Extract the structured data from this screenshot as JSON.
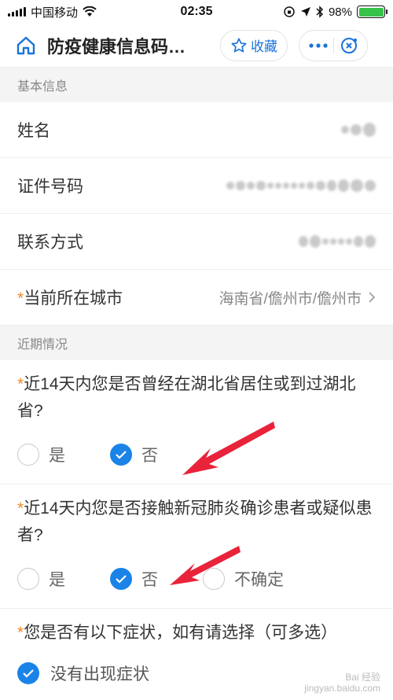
{
  "status_bar": {
    "carrier": "中国移动",
    "time": "02:35",
    "battery": "98%"
  },
  "nav": {
    "title": "防疫健康信息码…",
    "favorite_label": "收藏"
  },
  "sections": {
    "basic_info": "基本信息",
    "recent": "近期情况"
  },
  "fields": {
    "name_label": "姓名",
    "id_label": "证件号码",
    "contact_label": "联系方式",
    "city_required": "*",
    "city_label": "当前所在城市",
    "city_value": "海南省/儋州市/儋州市"
  },
  "questions": [
    {
      "required": "*",
      "text": "近14天内您是否曾经在湖北省居住或到过湖北省?",
      "options": [
        "是",
        "否"
      ],
      "selected": 1
    },
    {
      "required": "*",
      "text": "近14天内您是否接触新冠肺炎确诊患者或疑似患者?",
      "options": [
        "是",
        "否",
        "不确定"
      ],
      "selected": 1
    },
    {
      "required": "*",
      "text": "您是否有以下症状，如有请选择（可多选）"
    }
  ],
  "symptom_option": "没有出现症状",
  "watermark": {
    "line1": "Bai 经验",
    "line2": "jingyan.baidu.com"
  },
  "colors": {
    "accent": "#1a83e8",
    "required": "#f08a2a",
    "annotation_arrow": "#e8233a"
  }
}
